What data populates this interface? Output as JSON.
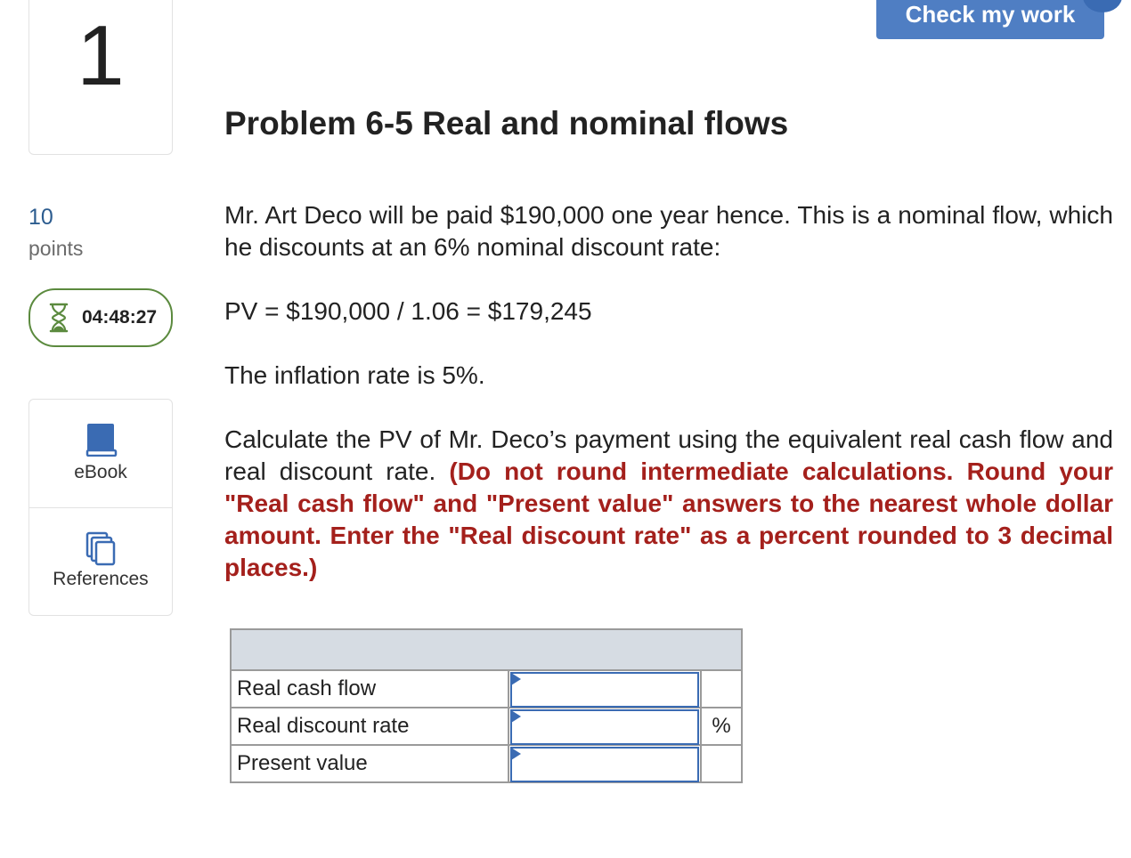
{
  "question": {
    "number": "1",
    "points_value": "10",
    "points_label": "points",
    "timer": "04:48:27"
  },
  "tools": {
    "ebook_label": "eBook",
    "references_label": "References"
  },
  "header": {
    "check_button_label": "Check my work"
  },
  "problem": {
    "title": "Problem 6-5 Real and nominal flows",
    "p1": "Mr. Art Deco will be paid $190,000 one year hence. This is a nominal flow, which he discounts at an 6% nominal discount rate:",
    "p2": "PV = $190,000 / 1.06 = $179,245",
    "p3": "The inflation rate is 5%.",
    "p4_plain": "Calculate the PV of Mr. Deco’s payment using the equivalent real cash flow and real discount rate.",
    "p4_instructions": "(Do not round intermediate calculations. Round your \"Real cash flow\" and \"Present value\" answers to the nearest whole dollar amount. Enter the \"Real discount rate\" as a percent rounded to 3 decimal places.)"
  },
  "answer_table": {
    "rows": [
      {
        "label": "Real cash flow",
        "value": "",
        "unit": ""
      },
      {
        "label": "Real discount rate",
        "value": "",
        "unit": "%"
      },
      {
        "label": "Present value",
        "value": "",
        "unit": ""
      }
    ]
  },
  "colors": {
    "accent_blue": "#4f7ec3",
    "instruction_red": "#a4201c",
    "timer_green": "#5b8a3e",
    "table_header_gray": "#d6dce3"
  },
  "icons": [
    "hourglass-icon",
    "ebook-icon",
    "references-icon"
  ]
}
